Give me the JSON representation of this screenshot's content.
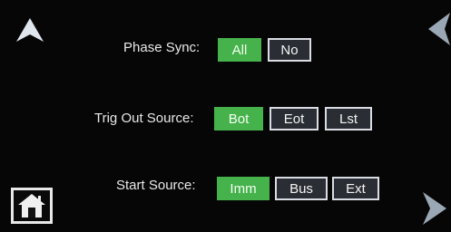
{
  "rows": [
    {
      "label": "Phase Sync:",
      "options": [
        "All",
        "No"
      ],
      "selected": "All"
    },
    {
      "label": "Trig Out Source:",
      "options": [
        "Bot",
        "Eot",
        "Lst"
      ],
      "selected": "Bot"
    },
    {
      "label": "Start Source:",
      "options": [
        "Imm",
        "Bus",
        "Ext"
      ],
      "selected": "Imm"
    }
  ],
  "icons": {
    "up": "up-arrow-icon",
    "left": "left-arrow-icon",
    "right": "right-arrow-icon",
    "home": "home-icon"
  },
  "colors": {
    "active": "#46b24c",
    "inactive": "#2a2d33",
    "text": "#e8e8e8"
  }
}
